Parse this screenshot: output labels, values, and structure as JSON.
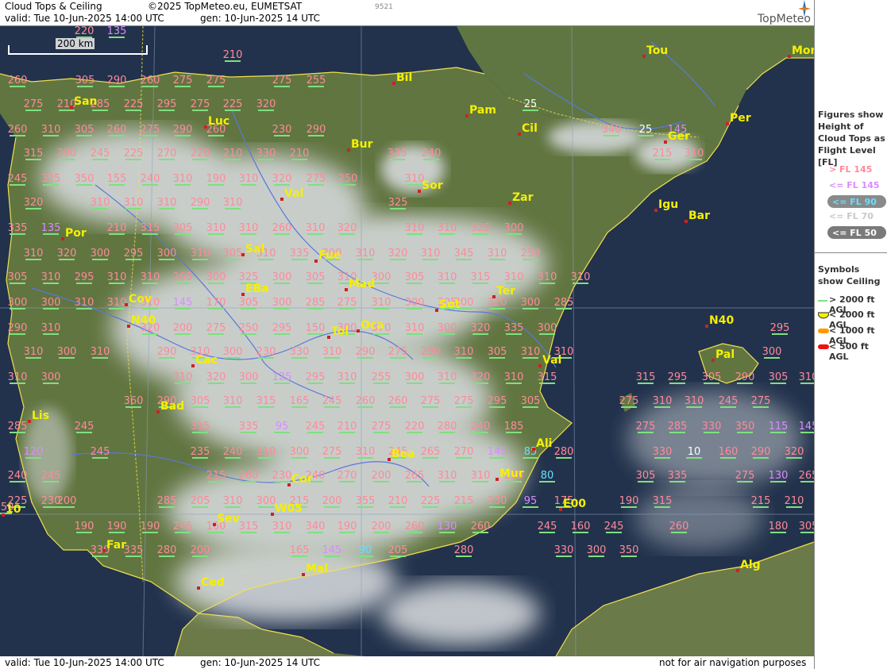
{
  "header": {
    "title": "Cloud Tops & Ceiling",
    "copyright": "©2025 TopMeteo.eu, EUMETSAT",
    "valid": "valid:  Tue  10-Jun-2025  14:00 UTC",
    "gen": "gen: 10-Jun-2025 14 UTC",
    "code": "9521",
    "logo": "TopMeteo"
  },
  "footer": {
    "valid": "valid:  Tue  10-Jun-2025  14:00 UTC",
    "gen": "gen: 10-Jun-2025 14 UTC",
    "disclaimer": "not for air navigation purposes"
  },
  "scale_bar": "200 km",
  "legend": {
    "tops_title": "Figures show Height of Cloud Tops as Flight Level  [FL]",
    "tops_items": [
      {
        "label": "> FL 145",
        "color": "#ff8a9a"
      },
      {
        "label": "<= FL 145",
        "color": "#d98cff"
      },
      {
        "label": "<= FL 90",
        "color": "#66e0ff"
      },
      {
        "label": "<= FL 70",
        "color": "#c8c8c8"
      },
      {
        "label": "<= FL 50",
        "color": "#ffffff"
      }
    ],
    "ceiling_title": "Symbols show Ceiling",
    "ceiling_items": [
      {
        "label": "> 2000 ft AGL",
        "color": "#7fe07f"
      },
      {
        "label": "< 2000 ft AGL",
        "color": "#f4f000"
      },
      {
        "label": "< 1000 ft AGL",
        "color": "#ff9900"
      },
      {
        "label": "< 500 ft AGL",
        "color": "#ee1111"
      }
    ]
  },
  "colors": {
    "sea": "#1f2f4a",
    "land": "#5a6e3a",
    "cloud": "#d8dce0",
    "coast": "#f0e050",
    "river": "#5a78d8",
    "city": "#f4f000"
  },
  "cities": [
    "Bil",
    "Tou",
    "Mon",
    "San",
    "Luc",
    "Pam",
    "Cil",
    "Per",
    "Bur",
    "Ger",
    "Val",
    "Sor",
    "Zar",
    "Igu",
    "Bar",
    "Por",
    "Sal",
    "Fue",
    "Mad",
    "EBa",
    "Ter",
    "Cov",
    "Sot",
    "N40",
    "Oca",
    "Tol",
    "Cac",
    "Val",
    "Pal",
    "N40",
    "Bad",
    "Lis",
    "Ali",
    "Bea",
    "Cor",
    "Mur",
    "E00",
    "W05",
    "Sev",
    "Far",
    "Mal",
    "Ced",
    "Alg",
    "10"
  ],
  "flight_levels": [
    "220",
    "135",
    "210",
    "260",
    "305",
    "290",
    "260",
    "275",
    "275",
    "275",
    "255",
    "275",
    "210",
    "285",
    "225",
    "295",
    "275",
    "225",
    "320",
    "25",
    "260",
    "310",
    "305",
    "260",
    "275",
    "290",
    "260",
    "230",
    "290",
    "340",
    "25",
    "145",
    "315",
    "290",
    "245",
    "225",
    "270",
    "220",
    "210",
    "330",
    "210",
    "335",
    "240",
    "215",
    "310",
    "245",
    "325",
    "350",
    "155",
    "240",
    "310",
    "190",
    "310",
    "320",
    "275",
    "250",
    "310",
    "320",
    "310",
    "310",
    "310",
    "290",
    "310",
    "325",
    "335",
    "135",
    "210",
    "315",
    "305",
    "310",
    "310",
    "260",
    "310",
    "320",
    "310",
    "310",
    "325",
    "300",
    "310",
    "320",
    "300",
    "295",
    "300",
    "310",
    "305",
    "310",
    "335",
    "300",
    "310",
    "320",
    "310",
    "345",
    "310",
    "250",
    "305",
    "310",
    "295",
    "310",
    "310",
    "265",
    "300",
    "325",
    "300",
    "305",
    "310",
    "300",
    "305",
    "310",
    "315",
    "310",
    "310",
    "310",
    "300",
    "300",
    "310",
    "310",
    "310",
    "145",
    "170",
    "305",
    "300",
    "285",
    "275",
    "310",
    "300",
    "305",
    "300",
    "320",
    "300",
    "285",
    "290",
    "310",
    "320",
    "200",
    "275",
    "250",
    "295",
    "150",
    "300",
    "370",
    "310",
    "300",
    "320",
    "335",
    "300",
    "295",
    "310",
    "300",
    "310",
    "290",
    "310",
    "300",
    "230",
    "330",
    "310",
    "290",
    "275",
    "290",
    "310",
    "305",
    "310",
    "310",
    "300",
    "310",
    "300",
    "310",
    "320",
    "300",
    "125",
    "295",
    "310",
    "255",
    "300",
    "310",
    "320",
    "310",
    "315",
    "315",
    "295",
    "305",
    "290",
    "305",
    "310",
    "360",
    "290",
    "305",
    "310",
    "315",
    "165",
    "245",
    "260",
    "260",
    "275",
    "275",
    "295",
    "305",
    "275",
    "310",
    "310",
    "245",
    "275",
    "285",
    "245",
    "315",
    "335",
    "95",
    "245",
    "210",
    "275",
    "220",
    "280",
    "240",
    "185",
    "275",
    "285",
    "330",
    "350",
    "115",
    "145",
    "120",
    "245",
    "235",
    "240",
    "310",
    "300",
    "275",
    "310",
    "245",
    "265",
    "270",
    "145",
    "85",
    "280",
    "330",
    "10",
    "160",
    "290",
    "320",
    "240",
    "245",
    "215",
    "260",
    "230",
    "240",
    "270",
    "200",
    "265",
    "310",
    "310",
    "295",
    "80",
    "305",
    "335",
    "275",
    "130",
    "265",
    "225",
    "230",
    "200",
    "285",
    "205",
    "310",
    "300",
    "215",
    "200",
    "355",
    "210",
    "225",
    "215",
    "230",
    "95",
    "175",
    "190",
    "315",
    "215",
    "210",
    "250",
    "190",
    "190",
    "190",
    "245",
    "160",
    "315",
    "310",
    "340",
    "190",
    "200",
    "260",
    "130",
    "260",
    "245",
    "160",
    "245",
    "260",
    "180",
    "305",
    "330",
    "335",
    "280",
    "200",
    "165",
    "145",
    "90",
    "205",
    "280",
    "330",
    "300",
    "350"
  ]
}
